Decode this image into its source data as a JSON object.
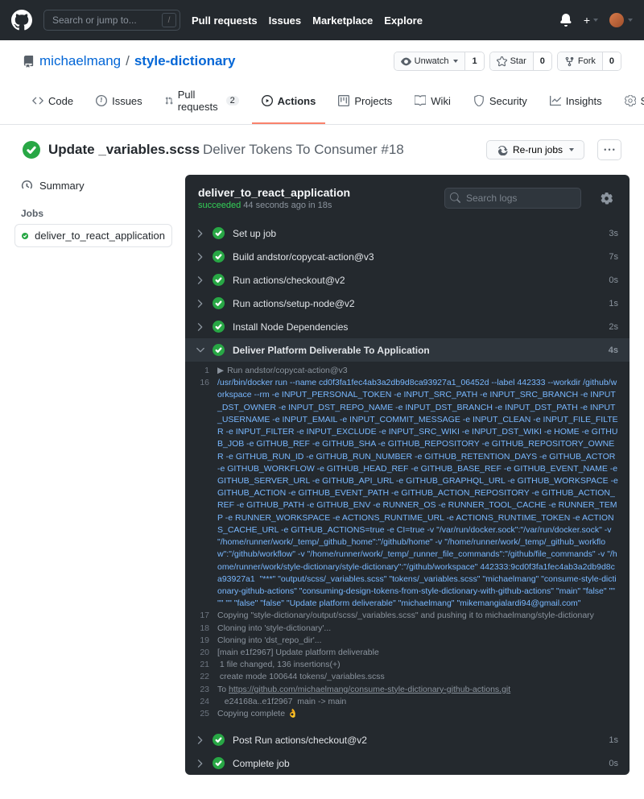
{
  "search_placeholder": "Search or jump to...",
  "topnav": [
    "Pull requests",
    "Issues",
    "Marketplace",
    "Explore"
  ],
  "repo": {
    "owner": "michaelmang",
    "name": "style-dictionary"
  },
  "repo_buttons": {
    "watch": {
      "label": "Unwatch",
      "count": "1"
    },
    "star": {
      "label": "Star",
      "count": "0"
    },
    "fork": {
      "label": "Fork",
      "count": "0"
    }
  },
  "tabs": [
    {
      "label": "Code"
    },
    {
      "label": "Issues"
    },
    {
      "label": "Pull requests",
      "count": "2"
    },
    {
      "label": "Actions",
      "active": true
    },
    {
      "label": "Projects"
    },
    {
      "label": "Wiki"
    },
    {
      "label": "Security"
    },
    {
      "label": "Insights"
    },
    {
      "label": "Settings"
    }
  ],
  "run": {
    "title": "Update _variables.scss",
    "subtitle": "Deliver Tokens To Consumer #18",
    "rerun": "Re-run jobs"
  },
  "sidebar": {
    "summary": "Summary",
    "jobs_header": "Jobs",
    "job": "deliver_to_react_application"
  },
  "job_head": {
    "title": "deliver_to_react_application",
    "status": "succeeded",
    "ago": "44 seconds ago",
    "in_word": "in",
    "dur": "18s",
    "search_placeholder": "Search logs"
  },
  "steps": [
    {
      "name": "Set up job",
      "dur": "3s"
    },
    {
      "name": "Build andstor/copycat-action@v3",
      "dur": "7s"
    },
    {
      "name": "Run actions/checkout@v2",
      "dur": "0s"
    },
    {
      "name": "Run actions/setup-node@v2",
      "dur": "1s"
    },
    {
      "name": "Install Node Dependencies",
      "dur": "2s"
    },
    {
      "name": "Deliver Platform Deliverable To Application",
      "dur": "4s",
      "open": true
    },
    {
      "name": "Post Run actions/checkout@v2",
      "dur": "1s"
    },
    {
      "name": "Complete job",
      "dur": "0s"
    }
  ],
  "log": {
    "l1_cmd": "Run andstor/copycat-action@v3",
    "l16": "/usr/bin/docker run --name cd0f3fa1fec4ab3a2db9d8ca93927a1_06452d --label 442333 --workdir /github/workspace --rm -e INPUT_PERSONAL_TOKEN -e INPUT_SRC_PATH -e INPUT_SRC_BRANCH -e INPUT_DST_OWNER -e INPUT_DST_REPO_NAME -e INPUT_DST_BRANCH -e INPUT_DST_PATH -e INPUT_USERNAME -e INPUT_EMAIL -e INPUT_COMMIT_MESSAGE -e INPUT_CLEAN -e INPUT_FILE_FILTER -e INPUT_FILTER -e INPUT_EXCLUDE -e INPUT_SRC_WIKI -e INPUT_DST_WIKI -e HOME -e GITHUB_JOB -e GITHUB_REF -e GITHUB_SHA -e GITHUB_REPOSITORY -e GITHUB_REPOSITORY_OWNER -e GITHUB_RUN_ID -e GITHUB_RUN_NUMBER -e GITHUB_RETENTION_DAYS -e GITHUB_ACTOR -e GITHUB_WORKFLOW -e GITHUB_HEAD_REF -e GITHUB_BASE_REF -e GITHUB_EVENT_NAME -e GITHUB_SERVER_URL -e GITHUB_API_URL -e GITHUB_GRAPHQL_URL -e GITHUB_WORKSPACE -e GITHUB_ACTION -e GITHUB_EVENT_PATH -e GITHUB_ACTION_REPOSITORY -e GITHUB_ACTION_REF -e GITHUB_PATH -e GITHUB_ENV -e RUNNER_OS -e RUNNER_TOOL_CACHE -e RUNNER_TEMP -e RUNNER_WORKSPACE -e ACTIONS_RUNTIME_URL -e ACTIONS_RUNTIME_TOKEN -e ACTIONS_CACHE_URL -e GITHUB_ACTIONS=true -e CI=true -v \"/var/run/docker.sock\":\"/var/run/docker.sock\" -v \"/home/runner/work/_temp/_github_home\":\"/github/home\" -v \"/home/runner/work/_temp/_github_workflow\":\"/github/workflow\" -v \"/home/runner/work/_temp/_runner_file_commands\":\"/github/file_commands\" -v \"/home/runner/work/style-dictionary/style-dictionary\":\"/github/workspace\" 442333:9cd0f3fa1fec4ab3a2db9d8ca93927a1  \"***\" \"output/scss/_variables.scss\" \"tokens/_variables.scss\" \"michaelmang\" \"consume-style-dictionary-github-actions\" \"consuming-design-tokens-from-style-dictionary-with-github-actions\" \"main\" \"false\" \"\" \"\" \"\" \"false\" \"false\" \"Update platform deliverable\" \"michaelmang\" \"mikemangialardi94@gmail.com\"",
    "l17": "Copying \"style-dictionary/output/scss/_variables.scss\" and pushing it to michaelmang/style-dictionary",
    "l18": "Cloning into 'style-dictionary'...",
    "l19": "Cloning into 'dst_repo_dir'...",
    "l20": "[main e1f2967] Update platform deliverable",
    "l21": " 1 file changed, 136 insertions(+)",
    "l22": " create mode 100644 tokens/_variables.scss",
    "l23_pre": "To ",
    "l23_link": "https://github.com/michaelmang/consume-style-dictionary-github-actions.git",
    "l24": "   e24168a..e1f2967  main -> main",
    "l25": "Copying complete 👌"
  }
}
